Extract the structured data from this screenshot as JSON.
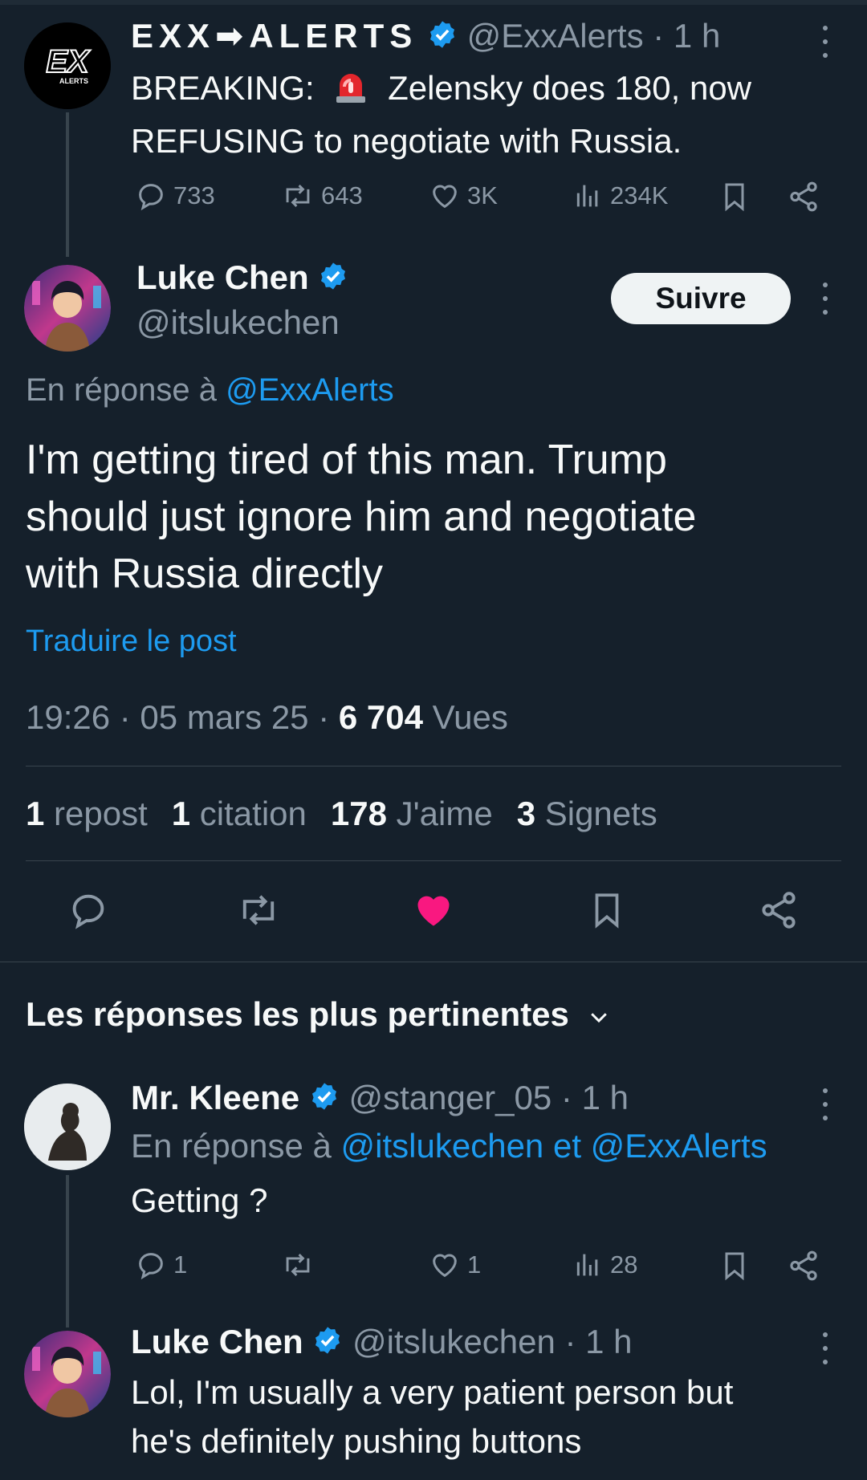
{
  "tweet1": {
    "name": "EXX➡ALERTS",
    "handle": "@ExxAlerts",
    "time": "· 1 h",
    "text_line1_pre": "BREAKING:",
    "text_line1_post": "Zelensky does 180, now",
    "text_line2": "REFUSING to negotiate with Russia.",
    "avatar_text": "EX",
    "avatar_sub": "ALERTS",
    "replies": "733",
    "reposts": "643",
    "likes": "3K",
    "views": "234K"
  },
  "main": {
    "name": "Luke Chen",
    "handle": "@itslukechen",
    "follow_label": "Suivre",
    "reply_to_prefix": "En réponse à",
    "reply_to_handle": "@ExxAlerts",
    "text_line1": "I'm getting tired of this man. Trump",
    "text_line2": "should just ignore him and negotiate",
    "text_line3": "with Russia directly",
    "translate": "Traduire le post",
    "timestamp": "19:26 · 05 mars 25 · ",
    "views_count": "6 704",
    "views_label": "Vues",
    "stats": {
      "reposts_count": "1",
      "reposts_label": "repost",
      "quotes_count": "1",
      "quotes_label": "citation",
      "likes_count": "178",
      "likes_label": "J'aime",
      "bookmarks_count": "3",
      "bookmarks_label": "Signets"
    }
  },
  "replies_header": "Les réponses les plus pertinentes",
  "reply1": {
    "name": "Mr. Kleene",
    "handle": "@stanger_05",
    "time": "· 1 h",
    "reply_to_prefix": "En réponse à",
    "reply_to_handles": "@itslukechen et @ExxAlerts",
    "text": "Getting ?",
    "replies": "1",
    "likes": "1",
    "views": "28"
  },
  "reply2": {
    "name": "Luke Chen",
    "handle": "@itslukechen",
    "time": "· 1 h",
    "text_line1": "Lol, I'm usually a very patient person but",
    "text_line2": "he's definitely pushing buttons"
  },
  "colors": {
    "background": "#15202b",
    "text": "#f7f9f9",
    "muted": "#8b98a5",
    "link": "#1d9bf0",
    "like_active": "#f91880",
    "divider": "#38444d"
  }
}
